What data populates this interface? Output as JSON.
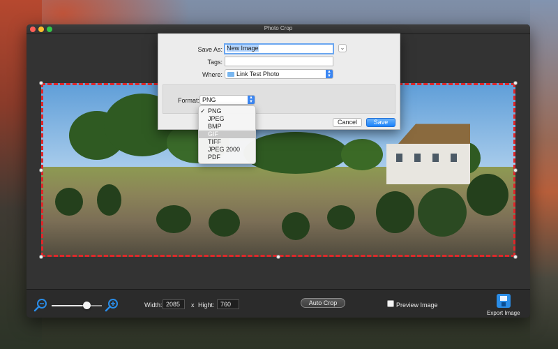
{
  "window": {
    "title": "Photo Crop"
  },
  "save_sheet": {
    "save_as_label": "Save As:",
    "save_as_value": "New Image",
    "tags_label": "Tags:",
    "tags_value": "",
    "where_label": "Where:",
    "where_value": "Link Test Photo",
    "format_label": "Format:",
    "format_value": "PNG",
    "cancel_label": "Cancel",
    "save_label": "Save"
  },
  "format_menu": {
    "items": [
      "PNG",
      "JPEG",
      "BMP",
      "GIF",
      "TIFF",
      "JPEG 2000",
      "PDF"
    ],
    "checked": "PNG",
    "highlighted": "GIF"
  },
  "toolbar": {
    "width_label": "Width:",
    "width_value": "2085",
    "x_separator": "x",
    "height_label": "Hight:",
    "height_value": "760",
    "auto_crop_label": "Auto Crop",
    "preview_label": "Preview Image",
    "preview_checked": false,
    "export_label": "Export Image",
    "zoom_level": 0.5
  },
  "colors": {
    "accent": "#1a82fb",
    "crop_dash_primary": "#e0262a",
    "crop_dash_secondary": "#3ad13f",
    "zoom_icon": "#2a8de8"
  },
  "icons": {
    "zoom_out": "zoom-out-icon",
    "zoom_in": "zoom-in-icon",
    "export": "export-disk-icon",
    "folder": "folder-icon"
  }
}
